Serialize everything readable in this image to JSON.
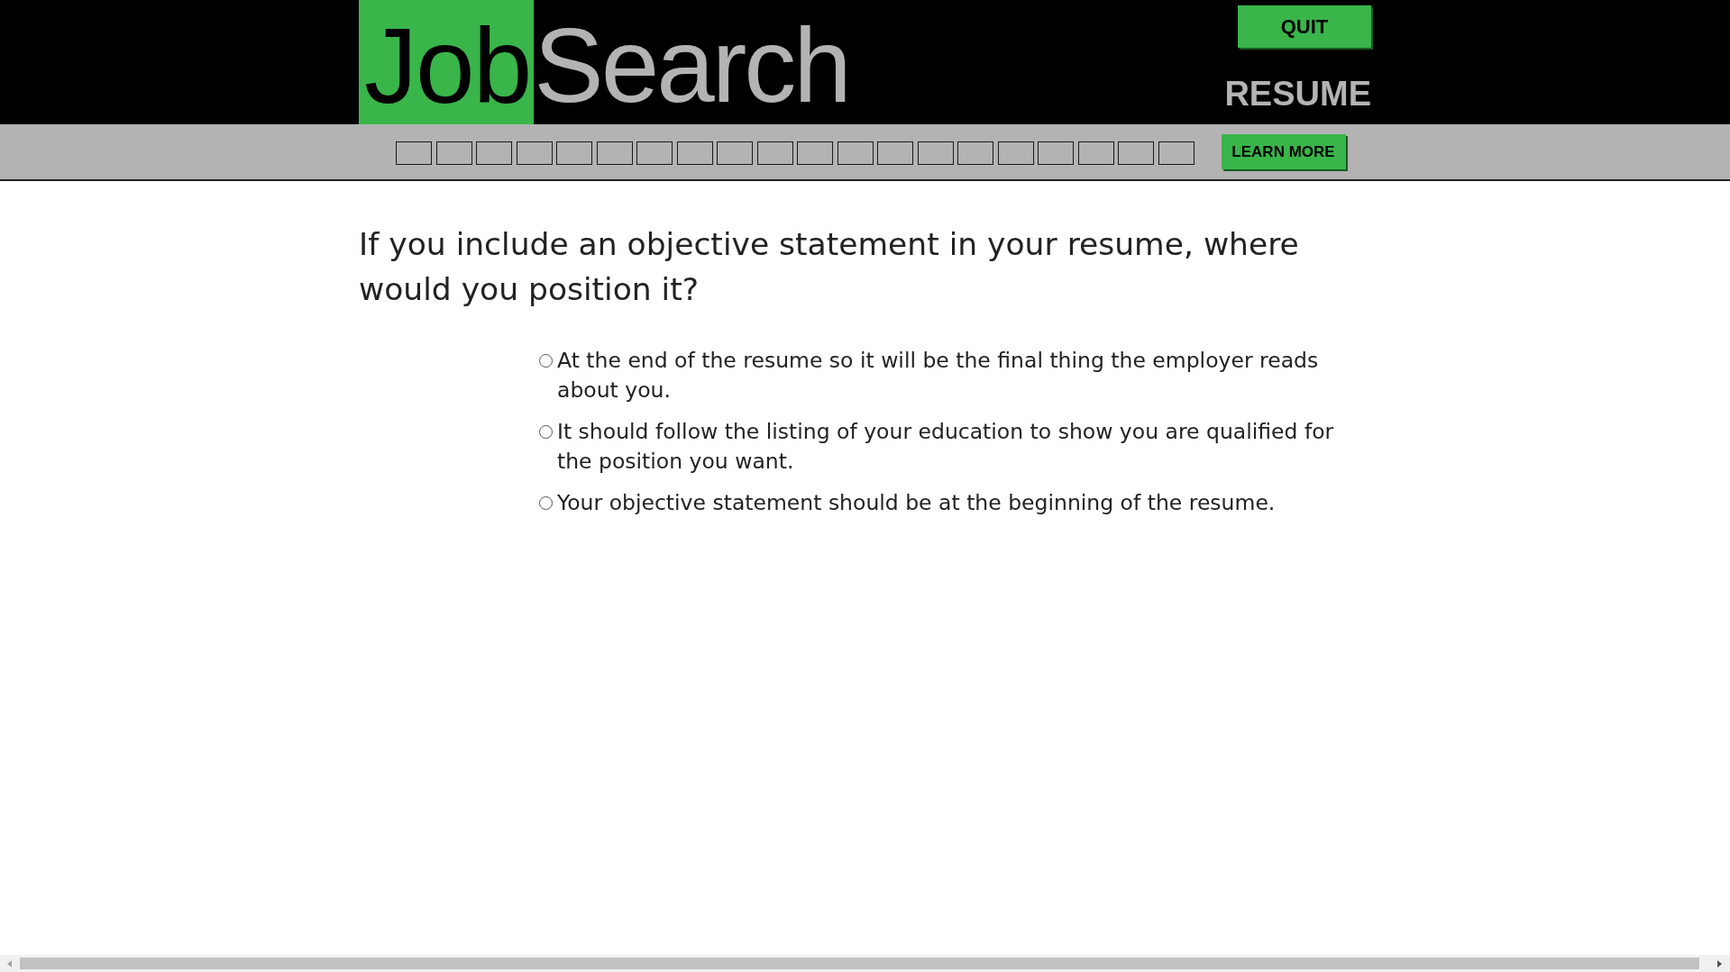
{
  "header": {
    "logo": {
      "highlight": "Job",
      "rest": "Search"
    },
    "quit_button": "QUIT",
    "section_title": "RESUME"
  },
  "progress_bar": {
    "steps": [
      {
        "filled": false
      },
      {
        "filled": false
      },
      {
        "filled": false
      },
      {
        "filled": false
      },
      {
        "filled": false
      },
      {
        "filled": false
      },
      {
        "filled": false
      },
      {
        "filled": false
      },
      {
        "filled": false
      },
      {
        "filled": false
      },
      {
        "filled": false
      },
      {
        "filled": false
      },
      {
        "filled": false
      },
      {
        "filled": false
      },
      {
        "filled": false
      },
      {
        "filled": false
      },
      {
        "filled": false
      },
      {
        "filled": false
      },
      {
        "filled": false
      },
      {
        "filled": false
      }
    ],
    "learn_more_button": "LEARN MORE"
  },
  "question": {
    "text": "If you include an objective statement in your resume, where would you position it?",
    "options": [
      {
        "label": "At the end of the resume so it will be the final thing the employer reads about you.",
        "selected": false
      },
      {
        "label": "It should follow the listing of your education to show you are qualified for the position you want.",
        "selected": false
      },
      {
        "label": "Your objective statement should be at the beginning of the resume.",
        "selected": false
      }
    ]
  }
}
